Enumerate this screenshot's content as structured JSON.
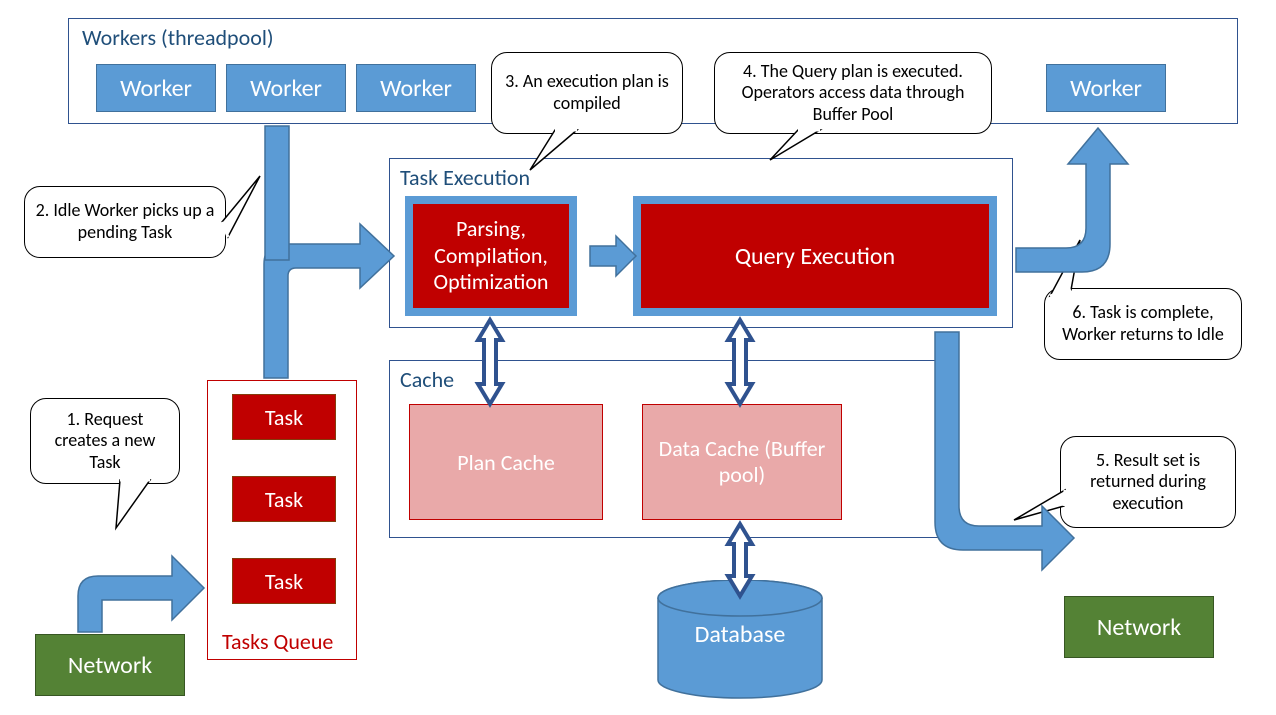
{
  "workers": {
    "title": "Workers (threadpool)",
    "items": [
      "Worker",
      "Worker",
      "Worker",
      "Worker"
    ]
  },
  "task_exec": {
    "title": "Task Execution",
    "parsing": "Parsing, Compilation, Optimization",
    "query": "Query Execution"
  },
  "cache": {
    "title": "Cache",
    "plan": "Plan Cache",
    "data": "Data Cache (Buffer pool)"
  },
  "tasks_queue": {
    "title": "Tasks Queue",
    "items": [
      "Task",
      "Task",
      "Task"
    ]
  },
  "database": "Database",
  "network": {
    "left": "Network",
    "right": "Network"
  },
  "callouts": {
    "c1": "1. Request creates a new Task",
    "c2": "2. Idle Worker picks up a pending Task",
    "c3": "3. An execution plan is compiled",
    "c4": "4. The Query plan is executed. Operators access data through Buffer Pool",
    "c5": "5. Result set is returned during execution",
    "c6": "6. Task is complete, Worker returns to Idle"
  }
}
